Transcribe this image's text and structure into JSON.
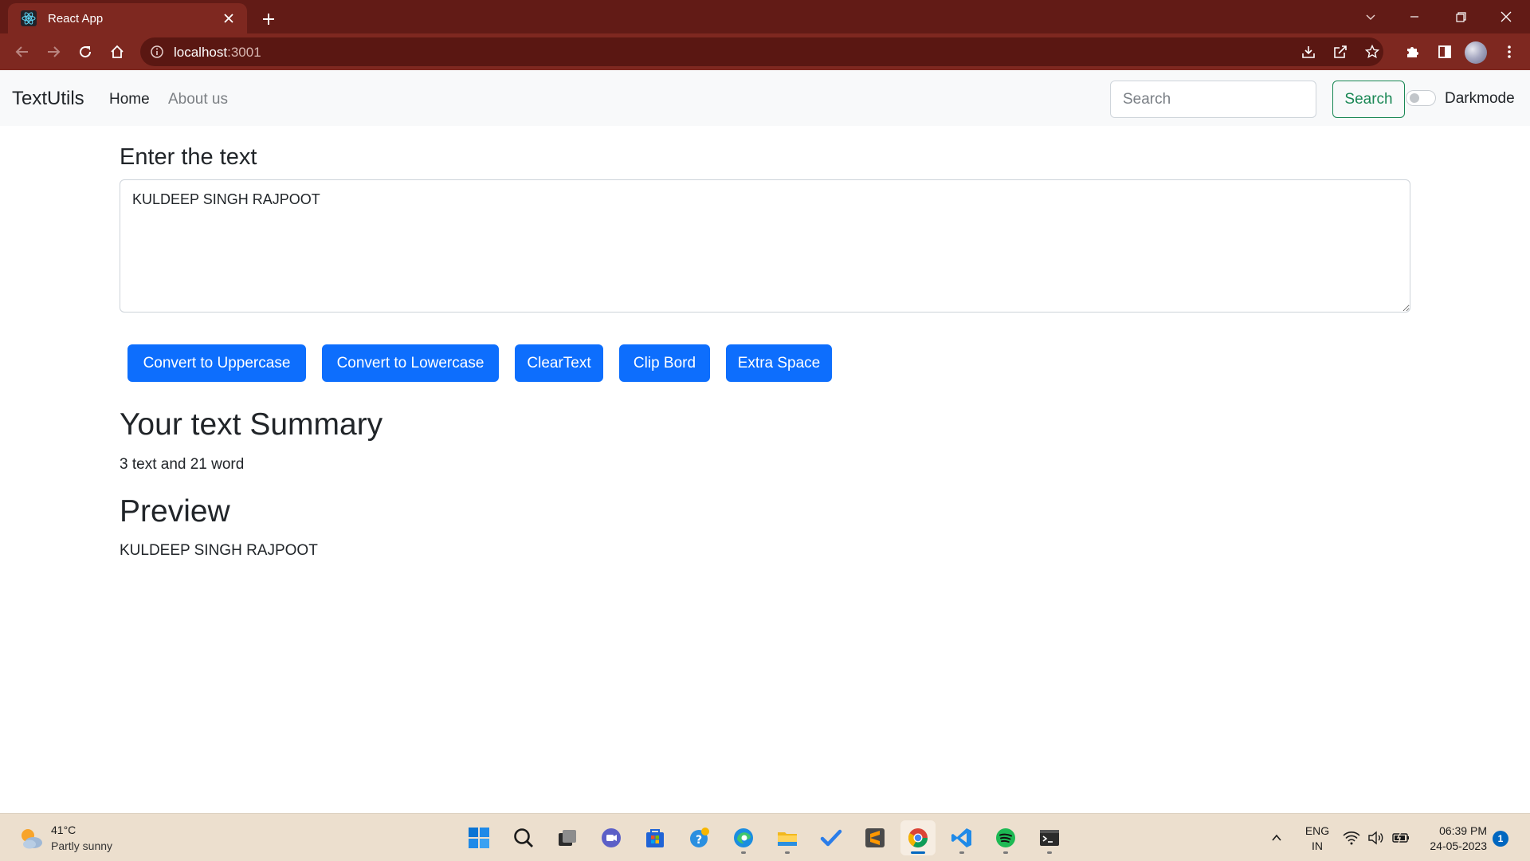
{
  "browser": {
    "tab_title": "React App",
    "url_host": "localhost",
    "url_port": ":3001"
  },
  "navbar": {
    "brand": "TextUtils",
    "links": [
      {
        "label": "Home"
      },
      {
        "label": "About us"
      }
    ],
    "search_placeholder": "Search",
    "search_button": "Search",
    "darkmode_label": "Darkmode",
    "darkmode_on": false
  },
  "main": {
    "heading": "Enter the text",
    "textarea_value": "KULDEEP SINGH RAJPOOT",
    "buttons": [
      {
        "label": "Convert to Uppercase"
      },
      {
        "label": "Convert to Lowercase"
      },
      {
        "label": "ClearText"
      },
      {
        "label": "Clip Bord"
      },
      {
        "label": "Extra Space"
      }
    ],
    "summary_title": "Your text Summary",
    "summary_text": "3 text and 21 word",
    "preview_title": "Preview",
    "preview_text": "KULDEEP SINGH RAJPOOT"
  },
  "taskbar": {
    "weather_temp": "41°C",
    "weather_desc": "Partly sunny",
    "apps": [
      "start-icon",
      "search-icon",
      "task-view-icon",
      "teams-chat-icon",
      "store-icon",
      "get-help-icon",
      "edge-icon",
      "file-explorer-icon",
      "todo-icon",
      "sublime-text-icon",
      "chrome-icon",
      "vscode-icon",
      "spotify-icon",
      "terminal-icon"
    ],
    "lang_line1": "ENG",
    "lang_line2": "IN",
    "time": "06:39 PM",
    "date": "24-05-2023",
    "notification_count": "1"
  },
  "colors": {
    "primary": "#0d6efd",
    "success": "#198754",
    "chrome_frame": "#621b16",
    "chrome_toolbar": "#7e2820"
  }
}
